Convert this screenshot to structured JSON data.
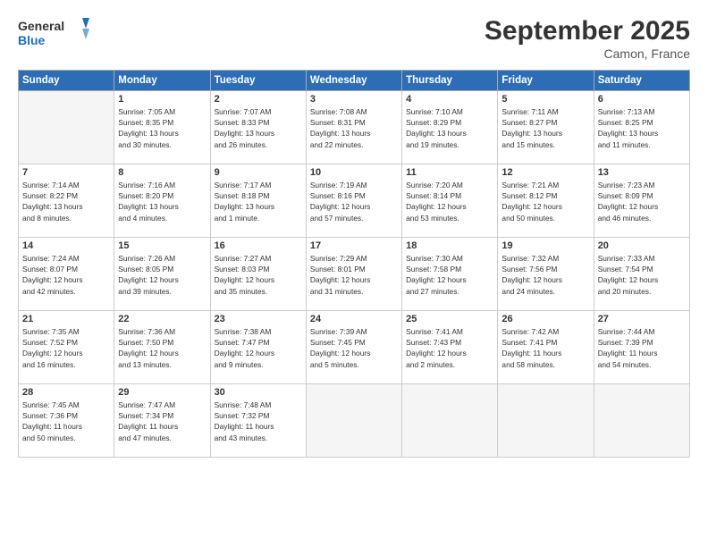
{
  "logo": {
    "line1": "General",
    "line2": "Blue"
  },
  "title": "September 2025",
  "subtitle": "Camon, France",
  "days_header": [
    "Sunday",
    "Monday",
    "Tuesday",
    "Wednesday",
    "Thursday",
    "Friday",
    "Saturday"
  ],
  "weeks": [
    [
      {
        "num": "",
        "lines": []
      },
      {
        "num": "1",
        "lines": [
          "Sunrise: 7:05 AM",
          "Sunset: 8:35 PM",
          "Daylight: 13 hours",
          "and 30 minutes."
        ]
      },
      {
        "num": "2",
        "lines": [
          "Sunrise: 7:07 AM",
          "Sunset: 8:33 PM",
          "Daylight: 13 hours",
          "and 26 minutes."
        ]
      },
      {
        "num": "3",
        "lines": [
          "Sunrise: 7:08 AM",
          "Sunset: 8:31 PM",
          "Daylight: 13 hours",
          "and 22 minutes."
        ]
      },
      {
        "num": "4",
        "lines": [
          "Sunrise: 7:10 AM",
          "Sunset: 8:29 PM",
          "Daylight: 13 hours",
          "and 19 minutes."
        ]
      },
      {
        "num": "5",
        "lines": [
          "Sunrise: 7:11 AM",
          "Sunset: 8:27 PM",
          "Daylight: 13 hours",
          "and 15 minutes."
        ]
      },
      {
        "num": "6",
        "lines": [
          "Sunrise: 7:13 AM",
          "Sunset: 8:25 PM",
          "Daylight: 13 hours",
          "and 11 minutes."
        ]
      }
    ],
    [
      {
        "num": "7",
        "lines": [
          "Sunrise: 7:14 AM",
          "Sunset: 8:22 PM",
          "Daylight: 13 hours",
          "and 8 minutes."
        ]
      },
      {
        "num": "8",
        "lines": [
          "Sunrise: 7:16 AM",
          "Sunset: 8:20 PM",
          "Daylight: 13 hours",
          "and 4 minutes."
        ]
      },
      {
        "num": "9",
        "lines": [
          "Sunrise: 7:17 AM",
          "Sunset: 8:18 PM",
          "Daylight: 13 hours",
          "and 1 minute."
        ]
      },
      {
        "num": "10",
        "lines": [
          "Sunrise: 7:19 AM",
          "Sunset: 8:16 PM",
          "Daylight: 12 hours",
          "and 57 minutes."
        ]
      },
      {
        "num": "11",
        "lines": [
          "Sunrise: 7:20 AM",
          "Sunset: 8:14 PM",
          "Daylight: 12 hours",
          "and 53 minutes."
        ]
      },
      {
        "num": "12",
        "lines": [
          "Sunrise: 7:21 AM",
          "Sunset: 8:12 PM",
          "Daylight: 12 hours",
          "and 50 minutes."
        ]
      },
      {
        "num": "13",
        "lines": [
          "Sunrise: 7:23 AM",
          "Sunset: 8:09 PM",
          "Daylight: 12 hours",
          "and 46 minutes."
        ]
      }
    ],
    [
      {
        "num": "14",
        "lines": [
          "Sunrise: 7:24 AM",
          "Sunset: 8:07 PM",
          "Daylight: 12 hours",
          "and 42 minutes."
        ]
      },
      {
        "num": "15",
        "lines": [
          "Sunrise: 7:26 AM",
          "Sunset: 8:05 PM",
          "Daylight: 12 hours",
          "and 39 minutes."
        ]
      },
      {
        "num": "16",
        "lines": [
          "Sunrise: 7:27 AM",
          "Sunset: 8:03 PM",
          "Daylight: 12 hours",
          "and 35 minutes."
        ]
      },
      {
        "num": "17",
        "lines": [
          "Sunrise: 7:29 AM",
          "Sunset: 8:01 PM",
          "Daylight: 12 hours",
          "and 31 minutes."
        ]
      },
      {
        "num": "18",
        "lines": [
          "Sunrise: 7:30 AM",
          "Sunset: 7:58 PM",
          "Daylight: 12 hours",
          "and 27 minutes."
        ]
      },
      {
        "num": "19",
        "lines": [
          "Sunrise: 7:32 AM",
          "Sunset: 7:56 PM",
          "Daylight: 12 hours",
          "and 24 minutes."
        ]
      },
      {
        "num": "20",
        "lines": [
          "Sunrise: 7:33 AM",
          "Sunset: 7:54 PM",
          "Daylight: 12 hours",
          "and 20 minutes."
        ]
      }
    ],
    [
      {
        "num": "21",
        "lines": [
          "Sunrise: 7:35 AM",
          "Sunset: 7:52 PM",
          "Daylight: 12 hours",
          "and 16 minutes."
        ]
      },
      {
        "num": "22",
        "lines": [
          "Sunrise: 7:36 AM",
          "Sunset: 7:50 PM",
          "Daylight: 12 hours",
          "and 13 minutes."
        ]
      },
      {
        "num": "23",
        "lines": [
          "Sunrise: 7:38 AM",
          "Sunset: 7:47 PM",
          "Daylight: 12 hours",
          "and 9 minutes."
        ]
      },
      {
        "num": "24",
        "lines": [
          "Sunrise: 7:39 AM",
          "Sunset: 7:45 PM",
          "Daylight: 12 hours",
          "and 5 minutes."
        ]
      },
      {
        "num": "25",
        "lines": [
          "Sunrise: 7:41 AM",
          "Sunset: 7:43 PM",
          "Daylight: 12 hours",
          "and 2 minutes."
        ]
      },
      {
        "num": "26",
        "lines": [
          "Sunrise: 7:42 AM",
          "Sunset: 7:41 PM",
          "Daylight: 11 hours",
          "and 58 minutes."
        ]
      },
      {
        "num": "27",
        "lines": [
          "Sunrise: 7:44 AM",
          "Sunset: 7:39 PM",
          "Daylight: 11 hours",
          "and 54 minutes."
        ]
      }
    ],
    [
      {
        "num": "28",
        "lines": [
          "Sunrise: 7:45 AM",
          "Sunset: 7:36 PM",
          "Daylight: 11 hours",
          "and 50 minutes."
        ]
      },
      {
        "num": "29",
        "lines": [
          "Sunrise: 7:47 AM",
          "Sunset: 7:34 PM",
          "Daylight: 11 hours",
          "and 47 minutes."
        ]
      },
      {
        "num": "30",
        "lines": [
          "Sunrise: 7:48 AM",
          "Sunset: 7:32 PM",
          "Daylight: 11 hours",
          "and 43 minutes."
        ]
      },
      {
        "num": "",
        "lines": []
      },
      {
        "num": "",
        "lines": []
      },
      {
        "num": "",
        "lines": []
      },
      {
        "num": "",
        "lines": []
      }
    ]
  ]
}
